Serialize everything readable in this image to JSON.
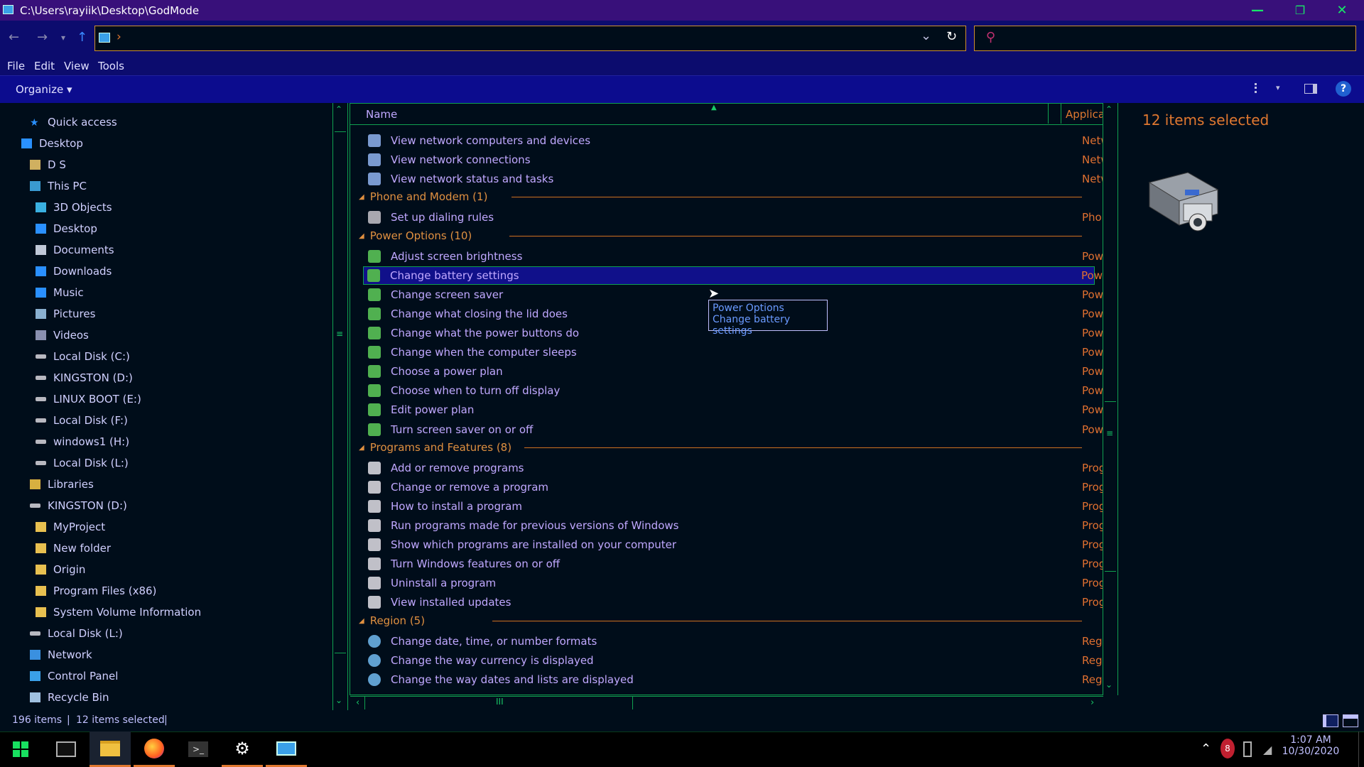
{
  "window": {
    "title": "C:\\Users\\rayiik\\Desktop\\GodMode",
    "min": "—",
    "max": "❐",
    "close": "✕"
  },
  "address": {
    "crumb_sep": "›",
    "dropdown": "⌄",
    "refresh": "↻",
    "search_icon": "⚲"
  },
  "menu": [
    "File",
    "Edit",
    "View",
    "Tools"
  ],
  "cmdbar": {
    "organize": "Organize ▾",
    "help": "?"
  },
  "nav": [
    {
      "label": "Quick access",
      "icon": "star-icon",
      "indent": 1
    },
    {
      "label": "Desktop",
      "icon": "desktop-icon",
      "indent": 0
    },
    {
      "label": "D S",
      "icon": "user-folder-icon",
      "indent": 1
    },
    {
      "label": "This PC",
      "icon": "computer-icon",
      "indent": 1
    },
    {
      "label": "3D Objects",
      "icon": "cube-icon",
      "indent": 2
    },
    {
      "label": "Desktop",
      "icon": "desktop-icon",
      "indent": 2
    },
    {
      "label": "Documents",
      "icon": "document-icon",
      "indent": 2
    },
    {
      "label": "Downloads",
      "icon": "download-icon",
      "indent": 2
    },
    {
      "label": "Music",
      "icon": "music-icon",
      "indent": 2
    },
    {
      "label": "Pictures",
      "icon": "picture-icon",
      "indent": 2
    },
    {
      "label": "Videos",
      "icon": "video-icon",
      "indent": 2
    },
    {
      "label": "Local Disk (C:)",
      "icon": "drive-icon",
      "indent": 2
    },
    {
      "label": "KINGSTON (D:)",
      "icon": "drive-icon",
      "indent": 2
    },
    {
      "label": "LINUX BOOT (E:)",
      "icon": "drive-icon",
      "indent": 2
    },
    {
      "label": "Local Disk (F:)",
      "icon": "drive-icon",
      "indent": 2
    },
    {
      "label": "windows1 (H:)",
      "icon": "drive-icon",
      "indent": 2
    },
    {
      "label": "Local Disk (L:)",
      "icon": "drive-icon",
      "indent": 2
    },
    {
      "label": "Libraries",
      "icon": "library-icon",
      "indent": 1
    },
    {
      "label": "KINGSTON (D:)",
      "icon": "drive-icon",
      "indent": 1
    },
    {
      "label": "MyProject",
      "icon": "folder-icon",
      "indent": 2
    },
    {
      "label": "New folder",
      "icon": "folder-icon",
      "indent": 2
    },
    {
      "label": "Origin",
      "icon": "folder-icon",
      "indent": 2
    },
    {
      "label": "Program Files (x86)",
      "icon": "folder-icon",
      "indent": 2
    },
    {
      "label": "System Volume Information",
      "icon": "folder-icon",
      "indent": 2
    },
    {
      "label": "Local Disk (L:)",
      "icon": "drive-icon",
      "indent": 1
    },
    {
      "label": "Network",
      "icon": "network-icon",
      "indent": 1
    },
    {
      "label": "Control Panel",
      "icon": "control-panel-icon",
      "indent": 1
    },
    {
      "label": "Recycle Bin",
      "icon": "recycle-bin-icon",
      "indent": 1
    }
  ],
  "columns": {
    "name": "Name",
    "app": "Applica"
  },
  "list": [
    {
      "kind": "item",
      "name": "View network computers and devices",
      "app": "Network",
      "icon": "network-icon"
    },
    {
      "kind": "item",
      "name": "View network connections",
      "app": "Network",
      "icon": "network-icon"
    },
    {
      "kind": "item",
      "name": "View network status and tasks",
      "app": "Network",
      "icon": "network-icon"
    },
    {
      "kind": "group",
      "name": "Phone and Modem (1)"
    },
    {
      "kind": "item",
      "name": "Set up dialing rules",
      "app": "Phone a",
      "icon": "phone-icon"
    },
    {
      "kind": "group",
      "name": "Power Options (10)"
    },
    {
      "kind": "item",
      "name": "Adjust screen brightness",
      "app": "Power O",
      "icon": "battery-icon"
    },
    {
      "kind": "item",
      "name": "Change battery settings",
      "app": "Power O",
      "icon": "battery-icon",
      "selected": true
    },
    {
      "kind": "item",
      "name": "Change screen saver",
      "app": "Power O",
      "icon": "battery-icon"
    },
    {
      "kind": "item",
      "name": "Change what closing the lid does",
      "app": "Power O",
      "icon": "battery-icon"
    },
    {
      "kind": "item",
      "name": "Change what the power buttons do",
      "app": "Power O",
      "icon": "battery-icon"
    },
    {
      "kind": "item",
      "name": "Change when the computer sleeps",
      "app": "Power O",
      "icon": "battery-icon"
    },
    {
      "kind": "item",
      "name": "Choose a power plan",
      "app": "Power O",
      "icon": "battery-icon"
    },
    {
      "kind": "item",
      "name": "Choose when to turn off display",
      "app": "Power O",
      "icon": "battery-icon"
    },
    {
      "kind": "item",
      "name": "Edit power plan",
      "app": "Power O",
      "icon": "battery-icon"
    },
    {
      "kind": "item",
      "name": "Turn screen saver on or off",
      "app": "Power O",
      "icon": "battery-icon"
    },
    {
      "kind": "group",
      "name": "Programs and Features (8)"
    },
    {
      "kind": "item",
      "name": "Add or remove programs",
      "app": "Program",
      "icon": "programs-icon"
    },
    {
      "kind": "item",
      "name": "Change or remove a program",
      "app": "Program",
      "icon": "programs-icon"
    },
    {
      "kind": "item",
      "name": "How to install a program",
      "app": "Program",
      "icon": "programs-icon"
    },
    {
      "kind": "item",
      "name": "Run programs made for previous versions of Windows",
      "app": "Program",
      "icon": "programs-icon"
    },
    {
      "kind": "item",
      "name": "Show which programs are installed on your computer",
      "app": "Program",
      "icon": "programs-icon"
    },
    {
      "kind": "item",
      "name": "Turn Windows features on or off",
      "app": "Program",
      "icon": "programs-icon"
    },
    {
      "kind": "item",
      "name": "Uninstall a program",
      "app": "Program",
      "icon": "programs-icon"
    },
    {
      "kind": "item",
      "name": "View installed updates",
      "app": "Program",
      "icon": "programs-icon"
    },
    {
      "kind": "group",
      "name": "Region (5)"
    },
    {
      "kind": "item",
      "name": "Change date, time, or number formats",
      "app": "Region",
      "icon": "globe-icon"
    },
    {
      "kind": "item",
      "name": "Change the way currency is displayed",
      "app": "Region",
      "icon": "globe-icon"
    },
    {
      "kind": "item",
      "name": "Change the way dates and lists are displayed",
      "app": "Region",
      "icon": "globe-icon"
    }
  ],
  "tooltip": {
    "line1": "Power Options",
    "line2": "Change battery settings"
  },
  "preview": {
    "title": "12 items selected"
  },
  "status": {
    "count": "196 items",
    "selected": "12 items selected"
  },
  "clock": {
    "time": "1:07 AM",
    "date": "10/30/2020"
  },
  "colors": {
    "accent_orange": "#e07830",
    "selection": "#10108a",
    "border_green": "#10a050",
    "titlebar": "#38107a"
  }
}
